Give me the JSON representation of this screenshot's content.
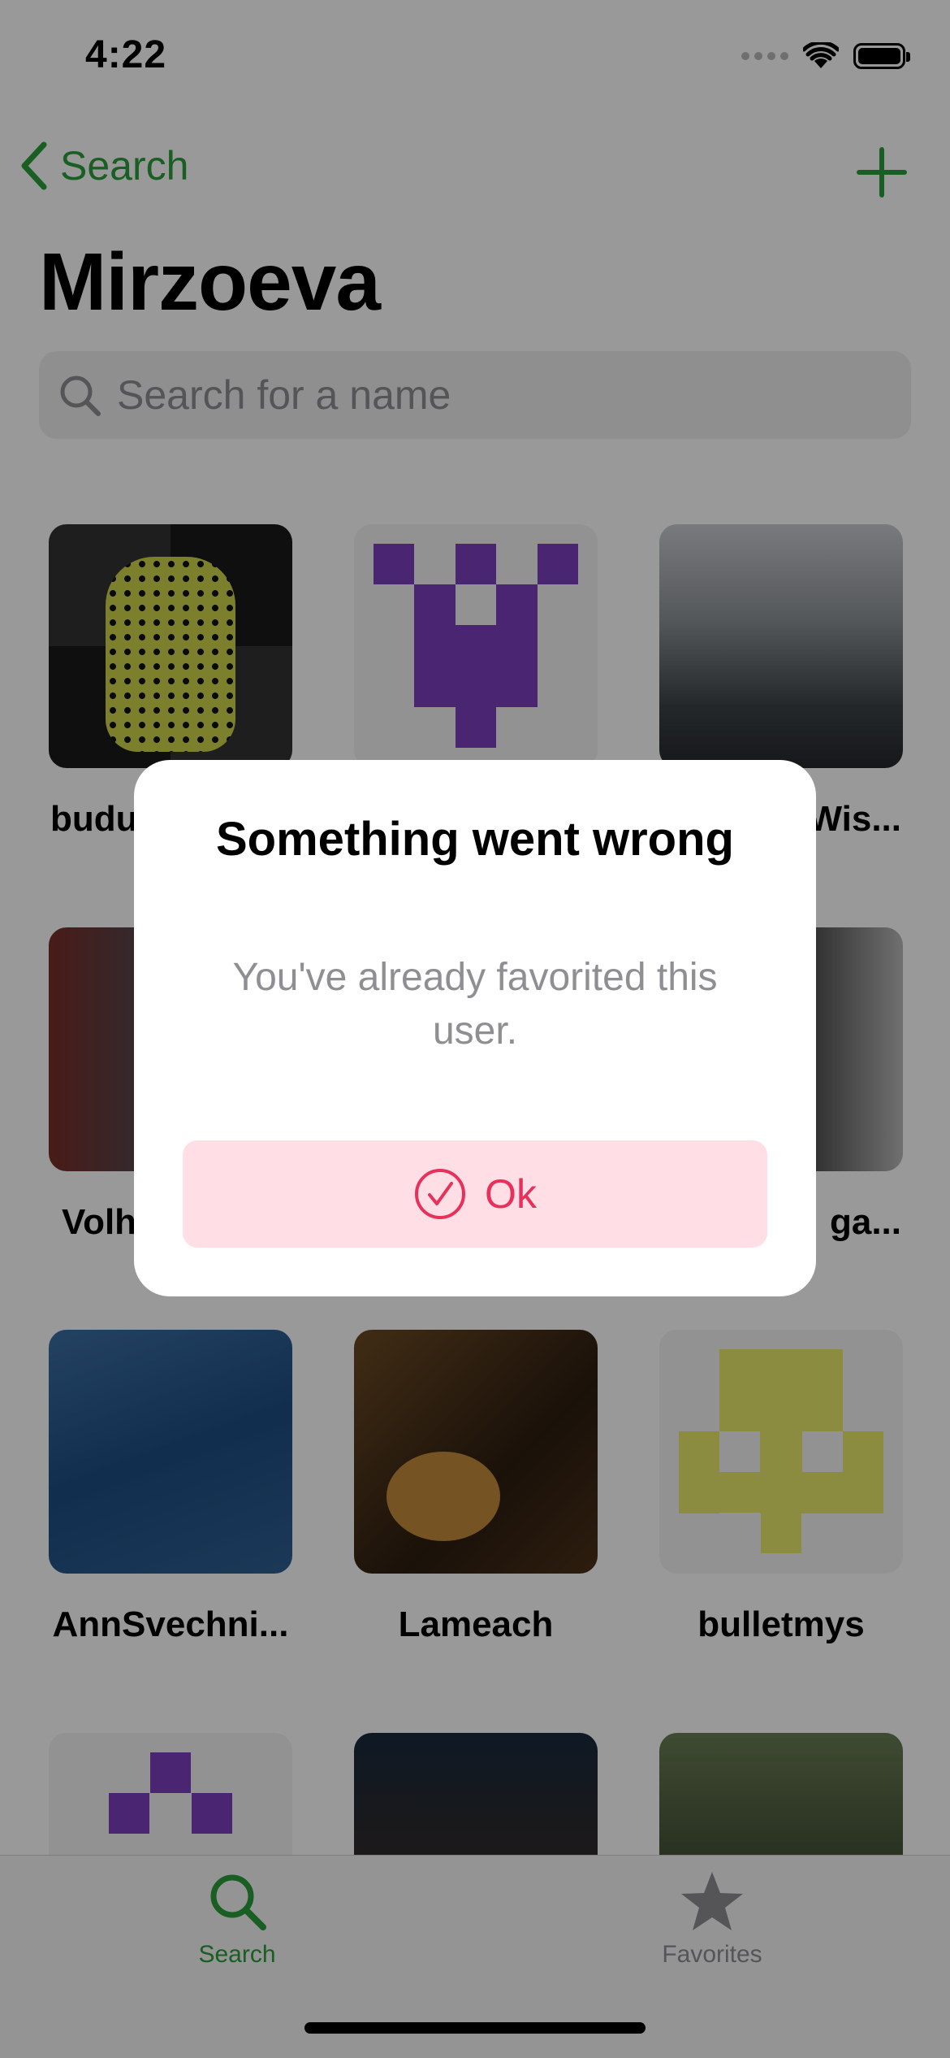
{
  "status_bar": {
    "time": "4:22"
  },
  "nav": {
    "back_label": "Search",
    "title": "Mirzoeva"
  },
  "search": {
    "placeholder": "Search for a name"
  },
  "grid": {
    "items": [
      {
        "name": "budu"
      },
      {
        "name": ""
      },
      {
        "name": "Wis..."
      },
      {
        "name": "Volh"
      },
      {
        "name": ""
      },
      {
        "name": "ga..."
      },
      {
        "name": "AnnSvechni..."
      },
      {
        "name": "Lameach"
      },
      {
        "name": "bulletmys"
      },
      {
        "name": ""
      },
      {
        "name": ""
      },
      {
        "name": ""
      }
    ]
  },
  "tab_bar": {
    "search_label": "Search",
    "favorites_label": "Favorites"
  },
  "alert": {
    "title": "Something went wrong",
    "message": "You've already favorited this user.",
    "button_label": "Ok"
  },
  "colors": {
    "accent_green": "#2a9d3a",
    "alert_button_bg": "#ffdfe5",
    "alert_button_text": "#e8305a",
    "identicon_purple": "#7b3fbf",
    "identicon_yellow": "#e9ea6c"
  },
  "icons": [
    "chevron-left-icon",
    "plus-icon",
    "search-icon",
    "wifi-icon",
    "battery-icon",
    "star-icon",
    "checkmark-circle-icon"
  ]
}
